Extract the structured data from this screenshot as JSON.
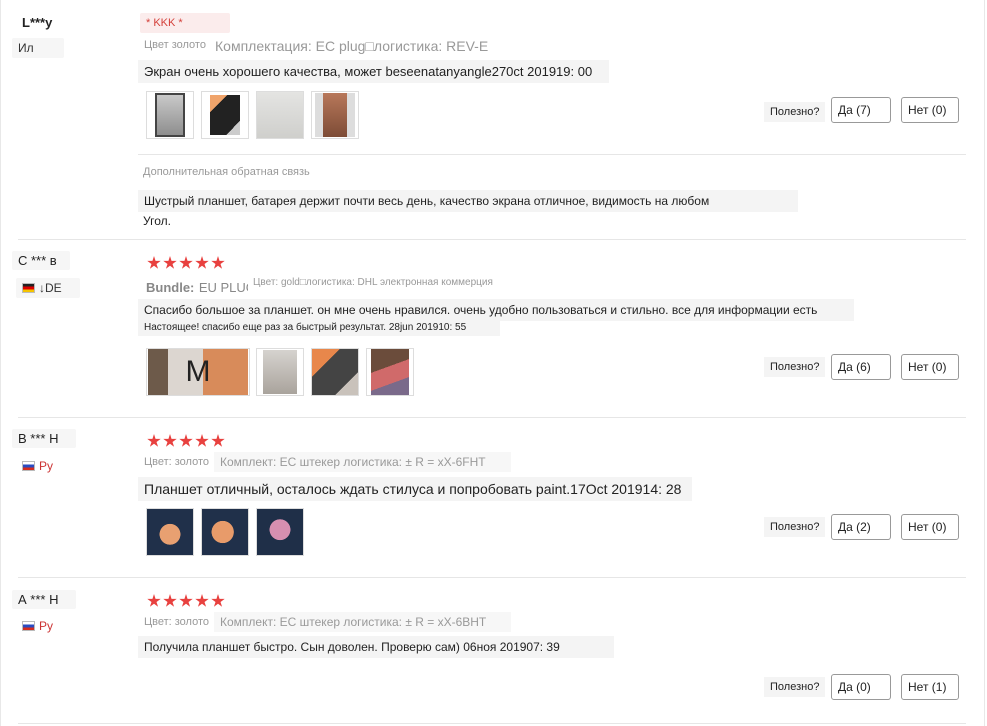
{
  "colors": {
    "star": "#e8413f",
    "tag": "#d4403a",
    "separator": "#e6e6e6"
  },
  "reviews": [
    {
      "user": "L***y",
      "country": "Ил",
      "tag": "* KKK *",
      "meta_color": "Цвет золото",
      "meta_config": "Комплектация: EC plug□логистика: REV-E",
      "text": "Экран очень хорошего качества, может beseenatanyangle270ct 201919: 00",
      "helpful_label": "Полезно?",
      "yes_label": "Да (7)",
      "no_label": "Нет (0)",
      "followup_label": "Дополнительная обратная связь",
      "followup_line1": "Шустрый планшет, батарея держит почти весь день, качество экрана отличное, видимость на любом",
      "followup_line2": "Угол."
    },
    {
      "user": "С *** в",
      "country": "↓DE",
      "rating": 5,
      "bundle_label": "Bundle:",
      "bundle_value": "EU PLUG",
      "meta_config": "Цвет: gold□логистика: DHL электронная коммерция",
      "text": "Спасибо большое за планшет. он мне очень нравился. очень удобно пользоваться и стильно. все для информации есть",
      "text2": "Настоящее! спасибо еще раз за быстрый результат. 28jun 201910: 55",
      "photo_letter": "M",
      "helpful_label": "Полезно?",
      "yes_label": "Да (6)",
      "no_label": "Нет (0)"
    },
    {
      "user": "В *** Н",
      "country": "Ру",
      "rating": 5,
      "meta_color": "Цвет: золото",
      "meta_config": "Комплект: EC штекер логистика: ± R = xX-6FHT",
      "text": "Планшет отличный, осталось ждать стилуса и попробовать paint.17Oct 201914: 28",
      "helpful_label": "Полезно?",
      "yes_label": "Да (2)",
      "no_label": "Нет (0)"
    },
    {
      "user": "А *** Н",
      "country": "Ру",
      "rating": 5,
      "meta_color": "Цвет: золото",
      "meta_config": "Комплект: EC штекер логистика: ± R = xX-6BHT",
      "text": "Получила планшет быстро. Сын доволен. Проверю сам) 06ноя 201907: 39",
      "helpful_label": "Полезно?",
      "yes_label": "Да (0)",
      "no_label": "Нет (1)"
    }
  ]
}
